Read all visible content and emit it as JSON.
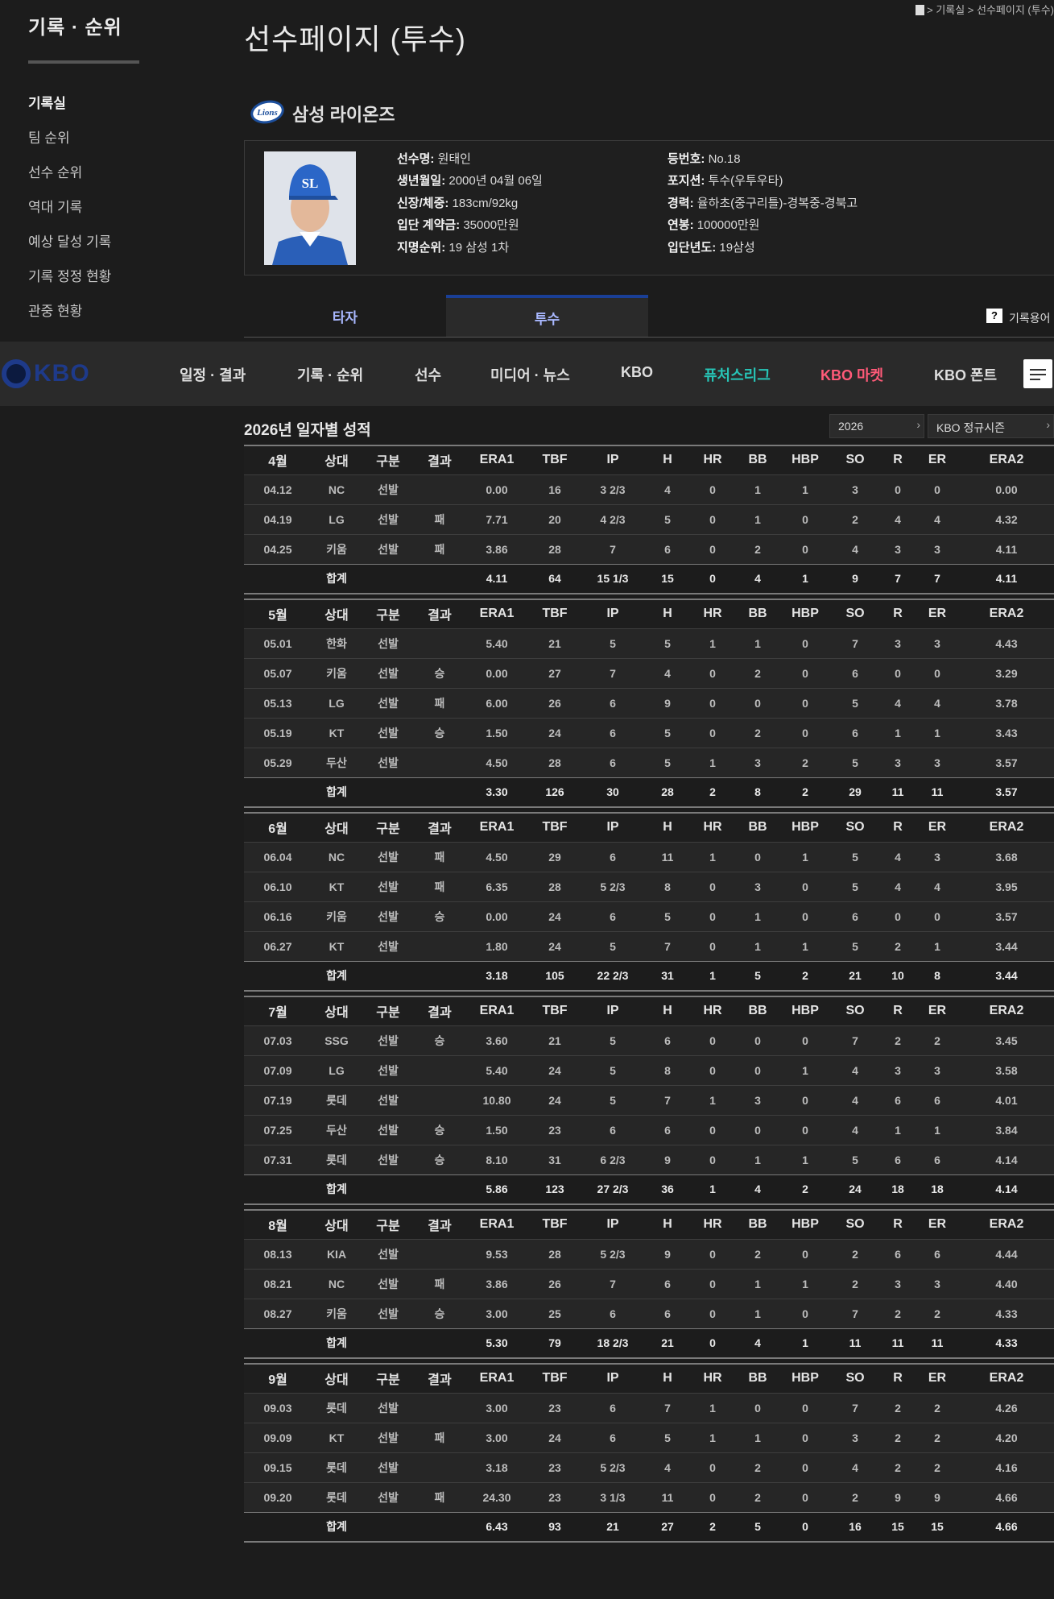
{
  "sidebar": {
    "title": "기록 · 순위",
    "items": [
      {
        "label": "기록실",
        "active": true
      },
      {
        "label": "팀 순위",
        "active": false
      },
      {
        "label": "선수 순위",
        "active": false
      },
      {
        "label": "역대 기록",
        "active": false
      },
      {
        "label": "예상 달성 기록",
        "active": false
      },
      {
        "label": "기록 정정 현황",
        "active": false
      },
      {
        "label": "관중 현황",
        "active": false
      }
    ]
  },
  "breadcrumb": "> 기록실 > 선수페이지 (투수)",
  "page_title": "선수페이지 (투수)",
  "team": {
    "name": "삼성 라이온즈",
    "logo_text": "Lions"
  },
  "player": {
    "cap_text": "SL",
    "left": [
      {
        "label": "선수명:",
        "value": "원태인"
      },
      {
        "label": "생년월일:",
        "value": "2000년 04월 06일"
      },
      {
        "label": "신장/체중:",
        "value": "183cm/92kg"
      },
      {
        "label": "입단 계약금:",
        "value": "35000만원"
      },
      {
        "label": "지명순위:",
        "value": "19 삼성 1차"
      }
    ],
    "right": [
      {
        "label": "등번호:",
        "value": "No.18"
      },
      {
        "label": "포지션:",
        "value": "투수(우투우타)"
      },
      {
        "label": "경력:",
        "value": "율하초(중구리틀)-경복중-경북고"
      },
      {
        "label": "연봉:",
        "value": "100000만원"
      },
      {
        "label": "입단년도:",
        "value": "19삼성"
      }
    ]
  },
  "tabs": {
    "batter": "타자",
    "pitcher": "투수",
    "help": "기록용어",
    "help_icon": "?"
  },
  "gnb": {
    "logo": "KBO",
    "items": [
      {
        "label": "일정 · 결과",
        "color": "#dedede"
      },
      {
        "label": "기록 · 순위",
        "color": "#dedede"
      },
      {
        "label": "선수",
        "color": "#dedede"
      },
      {
        "label": "미디어 · 뉴스",
        "color": "#dedede"
      },
      {
        "label": "KBO",
        "color": "#dedede"
      },
      {
        "label": "퓨처스리그",
        "color": "#27c4b6"
      },
      {
        "label": "KBO 마켓",
        "color": "#ff5a78"
      },
      {
        "label": "KBO 폰트",
        "color": "#dedede"
      }
    ]
  },
  "section": {
    "title": "2026년 일자별 성적",
    "year_select": "2026",
    "season_select": "KBO 정규시즌"
  },
  "columns": [
    "상대",
    "구분",
    "결과",
    "ERA1",
    "TBF",
    "IP",
    "H",
    "HR",
    "BB",
    "HBP",
    "SO",
    "R",
    "ER",
    "ERA2"
  ],
  "months": [
    {
      "month": "4월",
      "rows": [
        [
          "04.12",
          "NC",
          "선발",
          "",
          "0.00",
          "16",
          "3 2/3",
          "4",
          "0",
          "1",
          "1",
          "3",
          "0",
          "0",
          "0.00"
        ],
        [
          "04.19",
          "LG",
          "선발",
          "패",
          "7.71",
          "20",
          "4 2/3",
          "5",
          "0",
          "1",
          "0",
          "2",
          "4",
          "4",
          "4.32"
        ],
        [
          "04.25",
          "키움",
          "선발",
          "패",
          "3.86",
          "28",
          "7",
          "6",
          "0",
          "2",
          "0",
          "4",
          "3",
          "3",
          "4.11"
        ]
      ],
      "total": [
        "합계",
        "",
        "",
        "4.11",
        "64",
        "15 1/3",
        "15",
        "0",
        "4",
        "1",
        "9",
        "7",
        "7",
        "4.11"
      ]
    },
    {
      "month": "5월",
      "rows": [
        [
          "05.01",
          "한화",
          "선발",
          "",
          "5.40",
          "21",
          "5",
          "5",
          "1",
          "1",
          "0",
          "7",
          "3",
          "3",
          "4.43"
        ],
        [
          "05.07",
          "키움",
          "선발",
          "승",
          "0.00",
          "27",
          "7",
          "4",
          "0",
          "2",
          "0",
          "6",
          "0",
          "0",
          "3.29"
        ],
        [
          "05.13",
          "LG",
          "선발",
          "패",
          "6.00",
          "26",
          "6",
          "9",
          "0",
          "0",
          "0",
          "5",
          "4",
          "4",
          "3.78"
        ],
        [
          "05.19",
          "KT",
          "선발",
          "승",
          "1.50",
          "24",
          "6",
          "5",
          "0",
          "2",
          "0",
          "6",
          "1",
          "1",
          "3.43"
        ],
        [
          "05.29",
          "두산",
          "선발",
          "",
          "4.50",
          "28",
          "6",
          "5",
          "1",
          "3",
          "2",
          "5",
          "3",
          "3",
          "3.57"
        ]
      ],
      "total": [
        "합계",
        "",
        "",
        "3.30",
        "126",
        "30",
        "28",
        "2",
        "8",
        "2",
        "29",
        "11",
        "11",
        "3.57"
      ]
    },
    {
      "month": "6월",
      "rows": [
        [
          "06.04",
          "NC",
          "선발",
          "패",
          "4.50",
          "29",
          "6",
          "11",
          "1",
          "0",
          "1",
          "5",
          "4",
          "3",
          "3.68"
        ],
        [
          "06.10",
          "KT",
          "선발",
          "패",
          "6.35",
          "28",
          "5 2/3",
          "8",
          "0",
          "3",
          "0",
          "5",
          "4",
          "4",
          "3.95"
        ],
        [
          "06.16",
          "키움",
          "선발",
          "승",
          "0.00",
          "24",
          "6",
          "5",
          "0",
          "1",
          "0",
          "6",
          "0",
          "0",
          "3.57"
        ],
        [
          "06.27",
          "KT",
          "선발",
          "",
          "1.80",
          "24",
          "5",
          "7",
          "0",
          "1",
          "1",
          "5",
          "2",
          "1",
          "3.44"
        ]
      ],
      "total": [
        "합계",
        "",
        "",
        "3.18",
        "105",
        "22 2/3",
        "31",
        "1",
        "5",
        "2",
        "21",
        "10",
        "8",
        "3.44"
      ]
    },
    {
      "month": "7월",
      "rows": [
        [
          "07.03",
          "SSG",
          "선발",
          "승",
          "3.60",
          "21",
          "5",
          "6",
          "0",
          "0",
          "0",
          "7",
          "2",
          "2",
          "3.45"
        ],
        [
          "07.09",
          "LG",
          "선발",
          "",
          "5.40",
          "24",
          "5",
          "8",
          "0",
          "0",
          "1",
          "4",
          "3",
          "3",
          "3.58"
        ],
        [
          "07.19",
          "롯데",
          "선발",
          "",
          "10.80",
          "24",
          "5",
          "7",
          "1",
          "3",
          "0",
          "4",
          "6",
          "6",
          "4.01"
        ],
        [
          "07.25",
          "두산",
          "선발",
          "승",
          "1.50",
          "23",
          "6",
          "6",
          "0",
          "0",
          "0",
          "4",
          "1",
          "1",
          "3.84"
        ],
        [
          "07.31",
          "롯데",
          "선발",
          "승",
          "8.10",
          "31",
          "6 2/3",
          "9",
          "0",
          "1",
          "1",
          "5",
          "6",
          "6",
          "4.14"
        ]
      ],
      "total": [
        "합계",
        "",
        "",
        "5.86",
        "123",
        "27 2/3",
        "36",
        "1",
        "4",
        "2",
        "24",
        "18",
        "18",
        "4.14"
      ]
    },
    {
      "month": "8월",
      "rows": [
        [
          "08.13",
          "KIA",
          "선발",
          "",
          "9.53",
          "28",
          "5 2/3",
          "9",
          "0",
          "2",
          "0",
          "2",
          "6",
          "6",
          "4.44"
        ],
        [
          "08.21",
          "NC",
          "선발",
          "패",
          "3.86",
          "26",
          "7",
          "6",
          "0",
          "1",
          "1",
          "2",
          "3",
          "3",
          "4.40"
        ],
        [
          "08.27",
          "키움",
          "선발",
          "승",
          "3.00",
          "25",
          "6",
          "6",
          "0",
          "1",
          "0",
          "7",
          "2",
          "2",
          "4.33"
        ]
      ],
      "total": [
        "합계",
        "",
        "",
        "5.30",
        "79",
        "18 2/3",
        "21",
        "0",
        "4",
        "1",
        "11",
        "11",
        "11",
        "4.33"
      ]
    },
    {
      "month": "9월",
      "rows": [
        [
          "09.03",
          "롯데",
          "선발",
          "",
          "3.00",
          "23",
          "6",
          "7",
          "1",
          "0",
          "0",
          "7",
          "2",
          "2",
          "4.26"
        ],
        [
          "09.09",
          "KT",
          "선발",
          "패",
          "3.00",
          "24",
          "6",
          "5",
          "1",
          "1",
          "0",
          "3",
          "2",
          "2",
          "4.20"
        ],
        [
          "09.15",
          "롯데",
          "선발",
          "",
          "3.18",
          "23",
          "5 2/3",
          "4",
          "0",
          "2",
          "0",
          "4",
          "2",
          "2",
          "4.16"
        ],
        [
          "09.20",
          "롯데",
          "선발",
          "패",
          "24.30",
          "23",
          "3 1/3",
          "11",
          "0",
          "2",
          "0",
          "2",
          "9",
          "9",
          "4.66"
        ]
      ],
      "total": [
        "합계",
        "",
        "",
        "6.43",
        "93",
        "21",
        "27",
        "2",
        "5",
        "0",
        "16",
        "15",
        "15",
        "4.66"
      ]
    }
  ]
}
